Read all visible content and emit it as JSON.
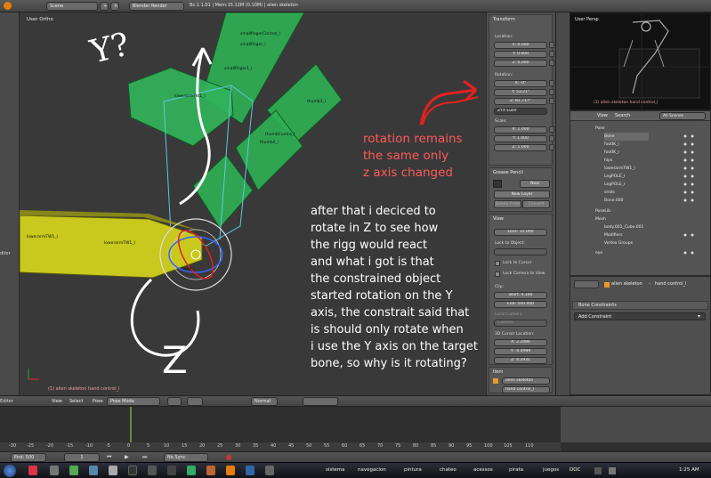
{
  "header": {
    "scene": "Scene",
    "render_engine": "Blender Render",
    "stats": "Bc:1.1.01 | Mem:15.12M (0.10M) | alien skeleton"
  },
  "viewport": {
    "view_label": "User Ortho",
    "status": "(1) alien skeleton hand control_l",
    "bones": {
      "smallfinger_control": "smallfingerControl_l",
      "smallfinger2": "smallfinger_l",
      "smallfinger1": "smallfinger1_l",
      "lowerarmtw": "lowerarmTW1_l",
      "thumb1": "thumb1_l",
      "thumb_control": "thumbContro_l",
      "thumb2": "thumb2_l",
      "lowerarm_left": "lowerarmTW1_l",
      "lowerarm_mid": "lowerarmTW1_l",
      "hand": "hand_l",
      "side_label": "ditor"
    }
  },
  "npanel": {
    "transform": "Transform",
    "location": "Location:",
    "loc": [
      "X: 0.000",
      "Y: 0.000",
      "Z: 0.000"
    ],
    "rotation": "Rotation:",
    "rot": [
      "X: -0°",
      "Y: 53.21°",
      "Z: 81.717°"
    ],
    "rot_mode": "ZYX Euler",
    "scale": "Scale:",
    "scl": [
      "X: 1.000",
      "Y: 1.000",
      "Z: 1.000"
    ],
    "grease": "Grease Pencil",
    "gp_new": "New",
    "gp_new_layer": "New Layer",
    "gp_delete": "Delete Fram",
    "gp_convert": "Convert",
    "view": "View",
    "lens": "Lens: 35.000",
    "lock_object": "Lock to Object:",
    "lock_cursor": "Lock to Cursor",
    "lock_camera": "Lock Camera to View",
    "clip": "Clip:",
    "clip_start": "Start: 0.100",
    "clip_end": "End: 500.000",
    "local_camera": "Local Camera",
    "camera": "Camera",
    "cursor_loc": "3D Cursor Location:",
    "cx": "X: 2.2486",
    "cy": "Y: -0.4989",
    "cz": "Z: 4.2931",
    "item": "Item",
    "item_obj": "alien skeleton",
    "item_bone": "hand control_l"
  },
  "rightpanel": {
    "view_label": "User Persp",
    "status": "(1) alien skeleton hand control_l",
    "menu": [
      "View",
      "Search"
    ],
    "scenes": "All Scenes",
    "outliner": [
      "Pose",
      "Bone",
      "footIK_l",
      "footIK_r",
      "hips",
      "lowerarmTW1_l",
      "LegPOLE_l",
      "LegPOLE_r",
      "smile",
      "Bone.000",
      "PoseLib",
      "Mesh",
      "body.001_Cube.001",
      "Modifiers",
      "Vertex Groups",
      "eye"
    ],
    "breadcrumb_obj": "alien skeleton",
    "breadcrumb_bone": "hand control_l",
    "bone_constraints": "Bone Constraints",
    "add_constraint": "Add Constraint"
  },
  "timeline": {
    "menu": [
      "View",
      "Select",
      "Pose"
    ],
    "mode": "Pose Mode",
    "pivot": "Normal",
    "ticks": [
      "-30",
      "-25",
      "-20",
      "-15",
      "-10",
      "-5",
      "0",
      "5",
      "10",
      "15",
      "20",
      "25",
      "30",
      "35",
      "40",
      "45",
      "50",
      "55",
      "60",
      "65",
      "70",
      "75",
      "80",
      "85",
      "90",
      "95",
      "100",
      "105",
      "110"
    ],
    "end": "End: 500",
    "frame": "1",
    "sync": "No Sync",
    "left_label": "Editor"
  },
  "taskbar": {
    "items": [
      "sistema",
      "navegacion",
      "pintura",
      "chateo",
      "acessos",
      "pirata",
      "juegos",
      "DOC"
    ],
    "time": "1:25 AM"
  },
  "annotations": {
    "red": [
      "rotation remains",
      "the same only",
      "z axis changed"
    ],
    "white": [
      "after that i deciced to",
      "rotate in Z to see how",
      "the rigg would react",
      "and what i got is that",
      "the constrained object",
      "started rotation on the Y",
      "axis, the constrait said that",
      "is should only rotate when",
      "i use the Y axis on the target",
      "bone, so why is it rotating?"
    ],
    "sketch_text": "Y?",
    "sketch_z": "Z"
  }
}
